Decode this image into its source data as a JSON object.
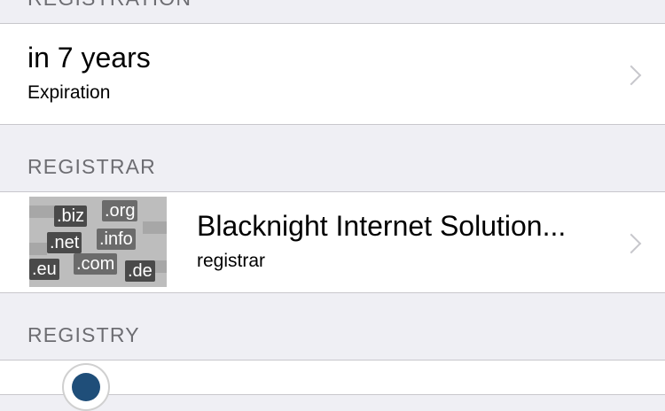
{
  "sections": {
    "registration_header": "REGISTRATION",
    "registrar_header": "REGISTRAR",
    "registry_header": "REGISTRY"
  },
  "expiration": {
    "value": "in 7 years",
    "label": "Expiration"
  },
  "registrar": {
    "name": "Blacknight Internet Solution...",
    "label": "registrar",
    "thumbnail_tlds": [
      ".biz",
      ".org",
      ".net",
      ".info",
      ".eu",
      ".com",
      ".de"
    ]
  },
  "icons": {
    "chevron": "chevron-right-icon",
    "registry_logo": "registry-logo-icon"
  },
  "colors": {
    "background": "#efeff4",
    "section_text": "#6d6d72",
    "separator": "#c8c7cc",
    "chevron": "#c7c7cc"
  }
}
